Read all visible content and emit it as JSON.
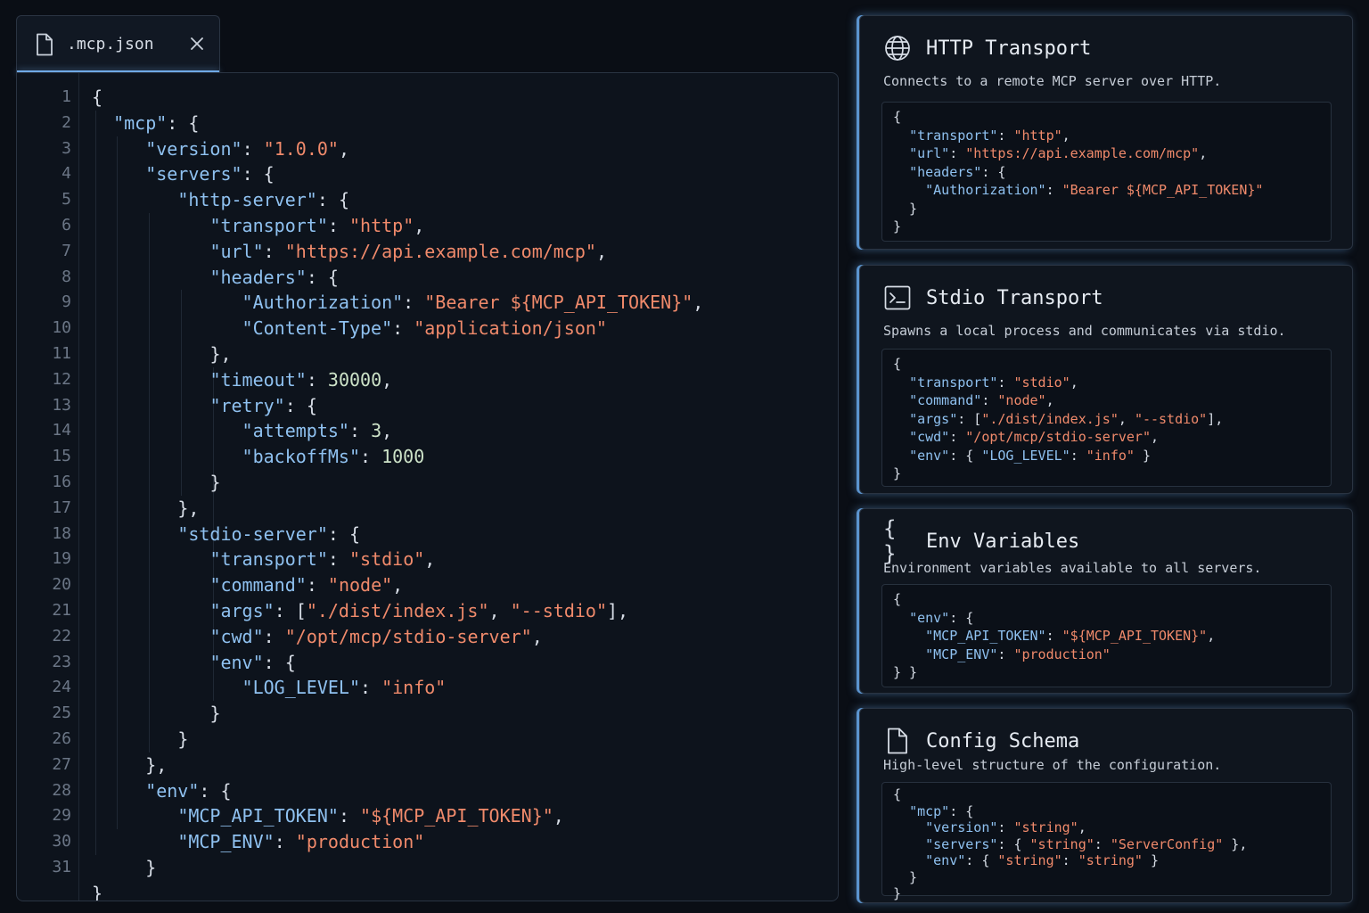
{
  "tab": {
    "title": ".mcp.json",
    "close_icon": "close-icon",
    "file_icon": "file-icon"
  },
  "editor": {
    "line_numbers": [
      "1",
      "2",
      "3",
      "4",
      "5",
      "6",
      "7",
      "8",
      "9",
      "10",
      "11",
      "12",
      "13",
      "14",
      "15",
      "16",
      "17",
      "18",
      "19",
      "20",
      "21",
      "22",
      "23",
      "24",
      "25",
      "26",
      "27",
      "28",
      "29",
      "30",
      "31"
    ],
    "lines": [
      [
        {
          "t": "p",
          "v": "{"
        }
      ],
      [
        {
          "t": "k",
          "v": "\"mcp\""
        },
        {
          "t": "p",
          "v": ": {"
        }
      ],
      [
        {
          "t": "k",
          "v": "\"version\""
        },
        {
          "t": "p",
          "v": ": "
        },
        {
          "t": "s",
          "v": "\"1.0.0\""
        },
        {
          "t": "p",
          "v": ","
        }
      ],
      [
        {
          "t": "k",
          "v": "\"servers\""
        },
        {
          "t": "p",
          "v": ": {"
        }
      ],
      [
        {
          "t": "k",
          "v": "\"http-server\""
        },
        {
          "t": "p",
          "v": ": {"
        }
      ],
      [
        {
          "t": "k",
          "v": "\"transport\""
        },
        {
          "t": "p",
          "v": ": "
        },
        {
          "t": "s",
          "v": "\"http\""
        },
        {
          "t": "p",
          "v": ","
        }
      ],
      [
        {
          "t": "k",
          "v": "\"url\""
        },
        {
          "t": "p",
          "v": ": "
        },
        {
          "t": "s",
          "v": "\"https://api.example.com/mcp\""
        },
        {
          "t": "p",
          "v": ","
        }
      ],
      [
        {
          "t": "k",
          "v": "\"headers\""
        },
        {
          "t": "p",
          "v": ": {"
        }
      ],
      [
        {
          "t": "k",
          "v": "\"Authorization\""
        },
        {
          "t": "p",
          "v": ": "
        },
        {
          "t": "s",
          "v": "\"Bearer ${MCP_API_TOKEN}\""
        },
        {
          "t": "p",
          "v": ","
        }
      ],
      [
        {
          "t": "k",
          "v": "\"Content-Type\""
        },
        {
          "t": "p",
          "v": ": "
        },
        {
          "t": "s",
          "v": "\"application/json\""
        }
      ],
      [
        {
          "t": "p",
          "v": "},"
        }
      ],
      [
        {
          "t": "k",
          "v": "\"timeout\""
        },
        {
          "t": "p",
          "v": ": "
        },
        {
          "t": "n",
          "v": "30000"
        },
        {
          "t": "p",
          "v": ","
        }
      ],
      [
        {
          "t": "k",
          "v": "\"retry\""
        },
        {
          "t": "p",
          "v": ": {"
        }
      ],
      [
        {
          "t": "k",
          "v": "\"attempts\""
        },
        {
          "t": "p",
          "v": ": "
        },
        {
          "t": "n",
          "v": "3"
        },
        {
          "t": "p",
          "v": ","
        }
      ],
      [
        {
          "t": "k",
          "v": "\"backoffMs\""
        },
        {
          "t": "p",
          "v": ": "
        },
        {
          "t": "n",
          "v": "1000"
        }
      ],
      [
        {
          "t": "p",
          "v": "}"
        }
      ],
      [
        {
          "t": "p",
          "v": "},"
        }
      ],
      [
        {
          "t": "k",
          "v": "\"stdio-server\""
        },
        {
          "t": "p",
          "v": ": {"
        }
      ],
      [
        {
          "t": "k",
          "v": "\"transport\""
        },
        {
          "t": "p",
          "v": ": "
        },
        {
          "t": "s",
          "v": "\"stdio\""
        },
        {
          "t": "p",
          "v": ","
        }
      ],
      [
        {
          "t": "k",
          "v": "\"command\""
        },
        {
          "t": "p",
          "v": ": "
        },
        {
          "t": "s",
          "v": "\"node\""
        },
        {
          "t": "p",
          "v": ","
        }
      ],
      [
        {
          "t": "k",
          "v": "\"args\""
        },
        {
          "t": "p",
          "v": ": ["
        },
        {
          "t": "s",
          "v": "\"./dist/index.js\""
        },
        {
          "t": "p",
          "v": ", "
        },
        {
          "t": "s",
          "v": "\"--stdio\""
        },
        {
          "t": "p",
          "v": "],"
        }
      ],
      [
        {
          "t": "k",
          "v": "\"cwd\""
        },
        {
          "t": "p",
          "v": ": "
        },
        {
          "t": "s",
          "v": "\"/opt/mcp/stdio-server\""
        },
        {
          "t": "p",
          "v": ","
        }
      ],
      [
        {
          "t": "k",
          "v": "\"env\""
        },
        {
          "t": "p",
          "v": ": {"
        }
      ],
      [
        {
          "t": "k",
          "v": "\"LOG_LEVEL\""
        },
        {
          "t": "p",
          "v": ": "
        },
        {
          "t": "s",
          "v": "\"info\""
        }
      ],
      [
        {
          "t": "p",
          "v": "}"
        }
      ],
      [
        {
          "t": "p",
          "v": "}"
        }
      ],
      [
        {
          "t": "p",
          "v": "},"
        }
      ],
      [
        {
          "t": "k",
          "v": "\"env\""
        },
        {
          "t": "p",
          "v": ": {"
        }
      ],
      [
        {
          "t": "k",
          "v": "\"MCP_API_TOKEN\""
        },
        {
          "t": "p",
          "v": ": "
        },
        {
          "t": "s",
          "v": "\"${MCP_API_TOKEN}\""
        },
        {
          "t": "p",
          "v": ","
        }
      ],
      [
        {
          "t": "k",
          "v": "\"MCP_ENV\""
        },
        {
          "t": "p",
          "v": ": "
        },
        {
          "t": "s",
          "v": "\"production\""
        }
      ],
      [
        {
          "t": "p",
          "v": "}"
        }
      ],
      [
        {
          "t": "p",
          "v": "}"
        }
      ]
    ]
  },
  "cards": [
    {
      "title": "HTTP Transport",
      "icon": "globe-icon",
      "description": "Connects to a remote MCP server over HTTP.",
      "snippet": [
        [
          {
            "t": "p",
            "v": "{"
          }
        ],
        [
          {
            "t": "p",
            "v": "  "
          },
          {
            "t": "k",
            "v": "\"transport\""
          },
          {
            "t": "p",
            "v": ": "
          },
          {
            "t": "s",
            "v": "\"http\""
          },
          {
            "t": "p",
            "v": ","
          }
        ],
        [
          {
            "t": "p",
            "v": "  "
          },
          {
            "t": "k",
            "v": "\"url\""
          },
          {
            "t": "p",
            "v": ": "
          },
          {
            "t": "s",
            "v": "\"https://api.example.com/mcp\""
          },
          {
            "t": "p",
            "v": ","
          }
        ],
        [
          {
            "t": "p",
            "v": "  "
          },
          {
            "t": "k",
            "v": "\"headers\""
          },
          {
            "t": "p",
            "v": ": {"
          }
        ],
        [
          {
            "t": "p",
            "v": "    "
          },
          {
            "t": "k",
            "v": "\"Authorization\""
          },
          {
            "t": "p",
            "v": ": "
          },
          {
            "t": "s",
            "v": "\"Bearer ${MCP_API_TOKEN}\""
          }
        ],
        [
          {
            "t": "p",
            "v": "  }"
          }
        ],
        [
          {
            "t": "p",
            "v": "}"
          }
        ]
      ]
    },
    {
      "title": "Stdio Transport",
      "icon": "terminal-icon",
      "description": "Spawns a local process and communicates via stdio.",
      "snippet": [
        [
          {
            "t": "p",
            "v": "{"
          }
        ],
        [
          {
            "t": "p",
            "v": "  "
          },
          {
            "t": "k",
            "v": "\"transport\""
          },
          {
            "t": "p",
            "v": ": "
          },
          {
            "t": "s",
            "v": "\"stdio\""
          },
          {
            "t": "p",
            "v": ","
          }
        ],
        [
          {
            "t": "p",
            "v": "  "
          },
          {
            "t": "k",
            "v": "\"command\""
          },
          {
            "t": "p",
            "v": ": "
          },
          {
            "t": "s",
            "v": "\"node\""
          },
          {
            "t": "p",
            "v": ","
          }
        ],
        [
          {
            "t": "p",
            "v": "  "
          },
          {
            "t": "k",
            "v": "\"args\""
          },
          {
            "t": "p",
            "v": ": ["
          },
          {
            "t": "s",
            "v": "\"./dist/index.js\""
          },
          {
            "t": "p",
            "v": ", "
          },
          {
            "t": "s",
            "v": "\"--stdio\""
          },
          {
            "t": "p",
            "v": "],"
          }
        ],
        [
          {
            "t": "p",
            "v": "  "
          },
          {
            "t": "k",
            "v": "\"cwd\""
          },
          {
            "t": "p",
            "v": ": "
          },
          {
            "t": "s",
            "v": "\"/opt/mcp/stdio-server\""
          },
          {
            "t": "p",
            "v": ","
          }
        ],
        [
          {
            "t": "p",
            "v": "  "
          },
          {
            "t": "k",
            "v": "\"env\""
          },
          {
            "t": "p",
            "v": ": { "
          },
          {
            "t": "k",
            "v": "\"LOG_LEVEL\""
          },
          {
            "t": "p",
            "v": ": "
          },
          {
            "t": "s",
            "v": "\"info\""
          },
          {
            "t": "p",
            "v": " }"
          }
        ],
        [
          {
            "t": "p",
            "v": "}"
          }
        ]
      ]
    },
    {
      "title": "Env Variables",
      "icon": "braces-icon",
      "description": "Environment variables available to all servers.",
      "snippet": [
        [
          {
            "t": "p",
            "v": "{"
          }
        ],
        [
          {
            "t": "p",
            "v": "  "
          },
          {
            "t": "k",
            "v": "\"env\""
          },
          {
            "t": "p",
            "v": ": {"
          }
        ],
        [
          {
            "t": "p",
            "v": "    "
          },
          {
            "t": "k",
            "v": "\"MCP_API_TOKEN\""
          },
          {
            "t": "p",
            "v": ": "
          },
          {
            "t": "s",
            "v": "\"${MCP_API_TOKEN}\""
          },
          {
            "t": "p",
            "v": ","
          }
        ],
        [
          {
            "t": "p",
            "v": "    "
          },
          {
            "t": "k",
            "v": "\"MCP_ENV\""
          },
          {
            "t": "p",
            "v": ": "
          },
          {
            "t": "s",
            "v": "\"production\""
          }
        ],
        [
          {
            "t": "p",
            "v": "} }"
          }
        ]
      ]
    },
    {
      "title": "Config Schema",
      "icon": "file-icon",
      "description": "High-level structure of the configuration.",
      "snippet": [
        [
          {
            "t": "p",
            "v": "{"
          }
        ],
        [
          {
            "t": "p",
            "v": "  "
          },
          {
            "t": "k",
            "v": "\"mcp\""
          },
          {
            "t": "p",
            "v": ": {"
          }
        ],
        [
          {
            "t": "p",
            "v": "    "
          },
          {
            "t": "k",
            "v": "\"version\""
          },
          {
            "t": "p",
            "v": ": "
          },
          {
            "t": "s",
            "v": "\"string\""
          },
          {
            "t": "p",
            "v": ","
          }
        ],
        [
          {
            "t": "p",
            "v": "    "
          },
          {
            "t": "k",
            "v": "\"servers\""
          },
          {
            "t": "p",
            "v": ": { "
          },
          {
            "t": "s",
            "v": "\"string\""
          },
          {
            "t": "p",
            "v": ": "
          },
          {
            "t": "s",
            "v": "\"ServerConfig\""
          },
          {
            "t": "p",
            "v": " },"
          }
        ],
        [
          {
            "t": "p",
            "v": "    "
          },
          {
            "t": "k",
            "v": "\"env\""
          },
          {
            "t": "p",
            "v": ": { "
          },
          {
            "t": "s",
            "v": "\"string\""
          },
          {
            "t": "p",
            "v": ": "
          },
          {
            "t": "s",
            "v": "\"string\""
          },
          {
            "t": "p",
            "v": " }"
          }
        ],
        [
          {
            "t": "p",
            "v": "  }"
          }
        ],
        [
          {
            "t": "p",
            "v": "}"
          }
        ]
      ]
    }
  ]
}
